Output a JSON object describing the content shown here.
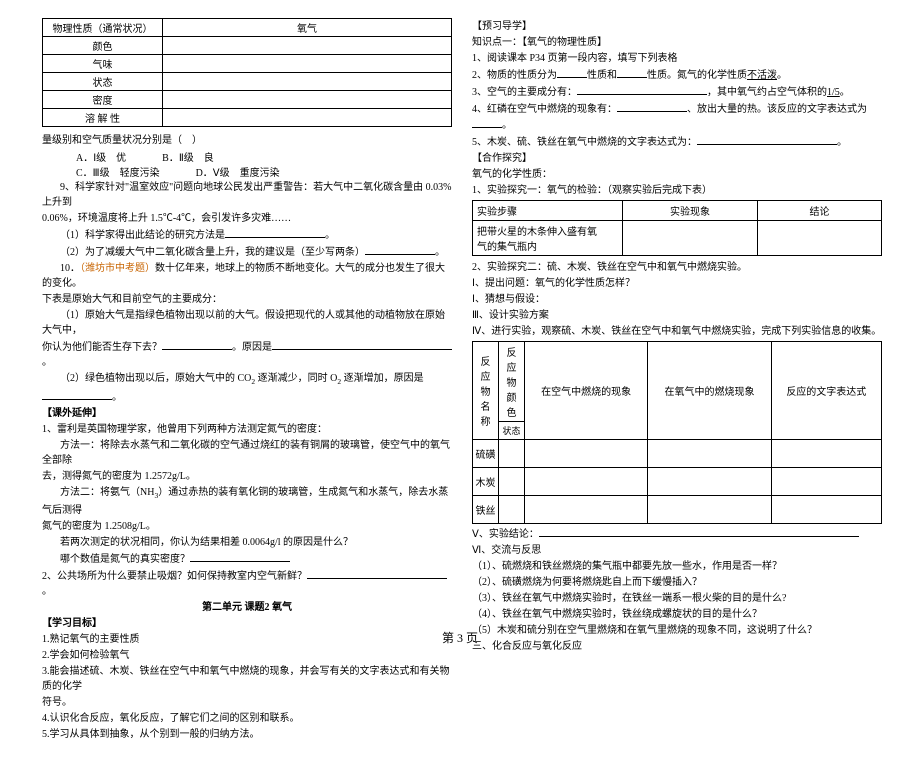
{
  "left": {
    "propTable": {
      "header1": "物理性质（通常状况）",
      "header2": "氧气",
      "rows": [
        "颜色",
        "气味",
        "状态",
        "密度",
        "溶 解 性"
      ]
    },
    "q_intro": "量级别和空气质量状况分别是（　）",
    "options": {
      "A": "A．Ⅰ级　优",
      "B": "B．Ⅱ级　良",
      "C": "C．Ⅲ级　轻度污染",
      "D": "D．Ⅴ级　重度污染"
    },
    "q9": "9、科学家针对\"温室效应\"问题向地球公民发出严重警告：若大气中二氧化碳含量由 0.03%上升到",
    "q9b": "0.06%，环境温度将上升 1.5℃-4℃，会引发许多灾难……",
    "q9_1": "（1）科学家得出此结论的研究方法是",
    "q9_1_end": "。",
    "q9_2": "（2）为了减缓大气中二氧化碳含量上升，我的建议是（至少写两条）",
    "q9_2_end": "。",
    "q10_pre": "10．",
    "q10_hl": "（潍坊市中考题）",
    "q10_post": "数十亿年来，地球上的物质不断地变化。大气的成分也发生了很大的变化。",
    "q10_line2": "下表是原始大气和目前空气的主要成分：",
    "q10_1a": "（1）原始大气是指绿色植物出现以前的大气。假设把现代的人或其他的动植物放在原始大气中，",
    "q10_1b": "你认为他们能否生存下去？",
    "q10_1c": "。原因是",
    "q10_1d": "。",
    "q10_2a": "（2）绿色植物出现以后，原始大气中的 CO",
    "q10_2b": " 逐渐减少，同时 O",
    "q10_2c": " 逐渐增加，原因是",
    "q10_2d": "。",
    "ext_title": "【课外延伸】",
    "ext_l1": "1、雷利是英国物理学家，他曾用下列两种方法测定氮气的密度：",
    "ext_l2a": "方法一：将除去水蒸气和二氧化碳的空气通过烧红的装有铜屑的玻璃管，使空气中的氧气全部除",
    "ext_l2b": "去，测得氮气的密度为 1.2572g/L。",
    "ext_l3a": "方法二：将氨气（NH",
    "ext_l3b": "）通过赤热的装有氧化铜的玻璃管，生成氮气和水蒸气，除去水蒸气后测得",
    "ext_l3c": "氮气的密度为 1.2508g/L。",
    "ext_l4": "若两次测定的状况相同，你认为结果相差 0.0064g/l 的原因是什么？",
    "ext_l5": "哪个数值是氮气的真实密度？",
    "ext_l6": "2、公共场所为什么要禁止吸烟？如何保持教室内空气新鲜？",
    "ext_l7": "。",
    "unit_title": "第二单元   课题2   氧气",
    "goals_h": "【学习目标】",
    "goal1": "1.熟记氧气的主要性质",
    "goal2": "2.学会如何检验氧气",
    "goal3a": "3.能会描述硫、木炭、铁丝在空气中和氧气中燃烧的现象，并会写有关的文字表达式和有关物质的化学",
    "goal3b": "符号。",
    "goal4": "4.认识化合反应，氧化反应，了解它们之间的区别和联系。",
    "goal5": "5.学习从具体到抽象，从个别到一般的归纳方法。"
  },
  "right": {
    "pre_h": "【预习导学】",
    "k1": "知识点一：【氧气的物理性质】",
    "l1": "1、阅读课本 P34 页第一段内容，填写下列表格",
    "l2a": "2、物质的性质分为",
    "l2b": "性质和",
    "l2c": "性质。氮气的化学性质",
    "l2d": "不活泼",
    "l2e": "。",
    "l3a": "3、空气的主要成分有：",
    "l3b": "，其中氧气约占空气体积的",
    "l3c": "1/5",
    "l3d": "。",
    "l4a": "4、红磷在空气中燃烧的现象有：",
    "l4b": "、放出大量的热。该反应的文字表达式为",
    "l4c": "。",
    "l5a": "5、木炭、硫、铁丝在氧气中燃烧的文字表达式为：",
    "l5b": "。",
    "coop_h": "【合作探究】",
    "coop_sub": "氧气的化学性质：",
    "exp1": "1、实验探究一：氧气的检验：（观察实验后完成下表）",
    "exp1_t": {
      "h1": "实验步骤",
      "h2": "实验现象",
      "h3": "结论",
      "r1a": "把带火星的木条伸入盛有氧",
      "r1b": "气的集气瓶内"
    },
    "exp2": "2、实验探究二：硫、木炭、铁丝在空气中和氧气中燃烧实验。",
    "exp2_1": "Ⅰ、提出问题：氧气的化学性质怎样？",
    "exp2_2": "Ⅰ、猜想与假设：",
    "exp2_3": "Ⅲ、设计实验方案",
    "exp2_4": "Ⅳ、进行实验，观察硫、木炭、铁丝在空气中和氧气中燃烧实验，完成下列实验信息的收集。",
    "rxn": {
      "h_a": "反　应",
      "h_b": "物　名",
      "h_c": "称",
      "h_d": "反　应",
      "h_e": "物　颜",
      "h_f": "色",
      "h_g": "状态",
      "h2": "在空气中燃烧的现象",
      "h3": "在氧气中的燃烧现象",
      "h4": "反应的文字表达式",
      "rows": [
        "硫磺",
        "木炭",
        "铁丝"
      ]
    },
    "concl": "Ⅴ、实验结论：",
    "reflect": "Ⅵ、交流与反思",
    "r1": "（1）、硫燃烧和铁丝燃烧的集气瓶中都要先放一些水，作用是否一样？",
    "r2": "（2）、硫磺燃烧为何要将燃烧匙自上而下缓慢插入？",
    "r3": "（3）、铁丝在氧气中燃烧实验时，在铁丝一端系一根火柴的目的是什么?",
    "r4": "（4）、铁丝在氧气中燃烧实验时，铁丝绕成螺旋状的目的是什么？",
    "r5": "（5）木炭和硫分别在空气里燃烧和在氧气里燃烧的现象不同，这说明了什么？",
    "sec3": "三、化合反应与氧化反应"
  },
  "footer": "第 3 页"
}
